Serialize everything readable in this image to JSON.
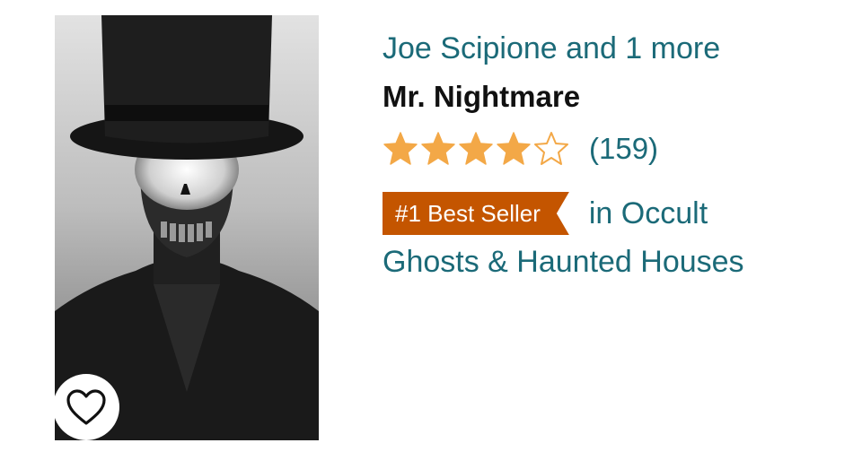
{
  "product": {
    "author": "Joe Scipione and 1 more",
    "title": "Mr. Nightmare",
    "rating": 4,
    "rating_max": 5,
    "rating_count": "(159)",
    "badge_label": "#1 Best Seller",
    "category_prefix": "in Occult",
    "category_rest": "Ghosts & Haunted Houses"
  },
  "icons": {
    "wishlist": "heart-outline-icon",
    "star_filled": "star-filled-icon",
    "star_empty": "star-outline-icon"
  },
  "colors": {
    "link": "#1b6a78",
    "star": "#f3a847",
    "badge": "#c45500"
  }
}
